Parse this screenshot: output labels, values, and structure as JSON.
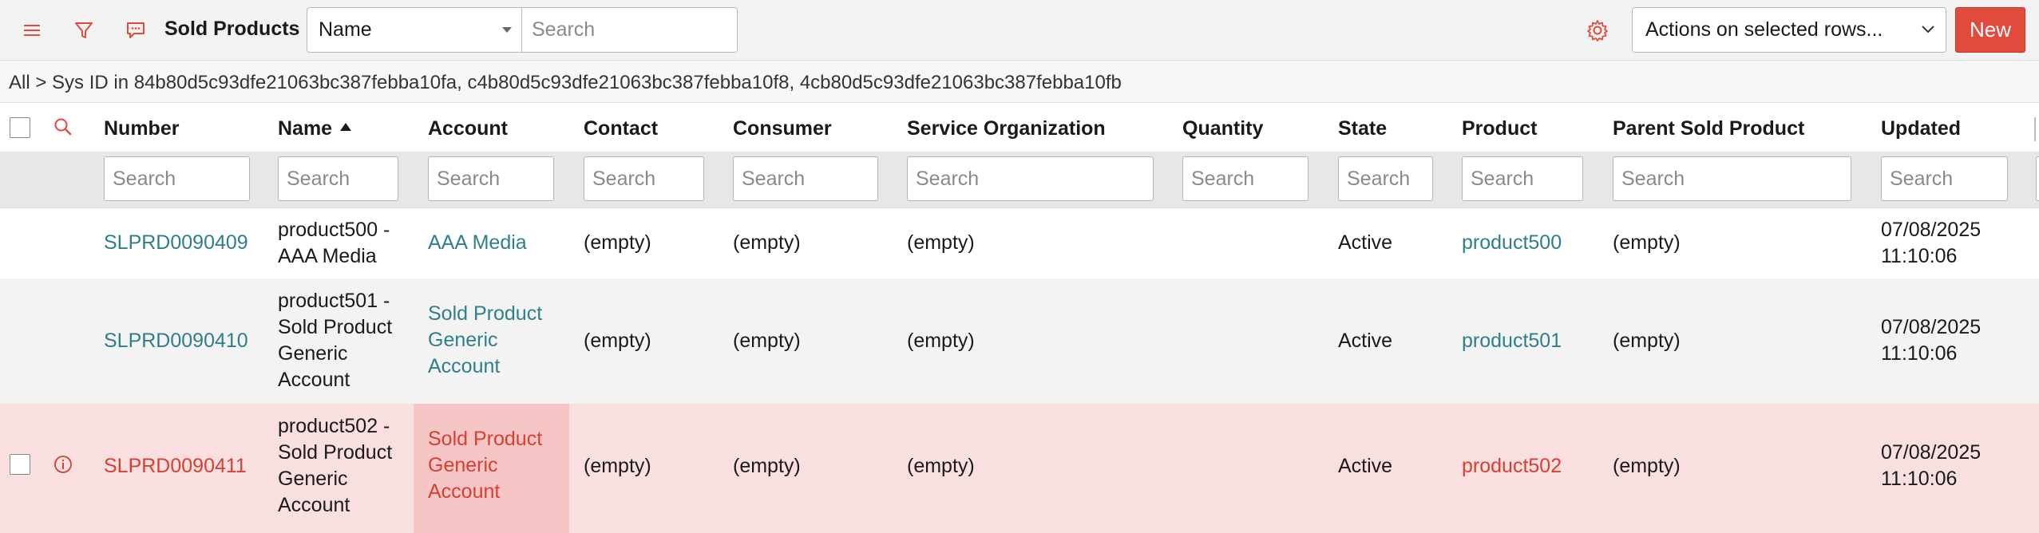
{
  "header": {
    "title": "Sold Products",
    "search_field": "Name",
    "search_placeholder": "Search",
    "actions_label": "Actions on selected rows...",
    "new_label": "New",
    "accent_color": "#e24a3b"
  },
  "breadcrumb": "All > Sys ID in 84b80d5c93dfe21063bc387febba10fa, c4b80d5c93dfe21063bc387febba10f8, 4cb80d5c93dfe21063bc387febba10fb",
  "columns": [
    "Number",
    "Name",
    "Account",
    "Contact",
    "Consumer",
    "Service Organization",
    "Quantity",
    "State",
    "Product",
    "Parent Sold Product",
    "Updated"
  ],
  "column_search_placeholder": "Search",
  "rows": [
    {
      "number": "SLPRD0090409",
      "name": [
        "product500 -",
        "AAA Media"
      ],
      "account": [
        "AAA Media"
      ],
      "contact": "(empty)",
      "consumer": "(empty)",
      "service_org": "(empty)",
      "quantity": "",
      "state": "Active",
      "product": "product500",
      "parent": "(empty)",
      "updated": [
        "07/08/2025",
        "11:10:06"
      ]
    },
    {
      "number": "SLPRD0090410",
      "name": [
        "product501 -",
        "Sold Product",
        "Generic",
        "Account"
      ],
      "account": [
        "Sold Product",
        "Generic",
        "Account"
      ],
      "contact": "(empty)",
      "consumer": "(empty)",
      "service_org": "(empty)",
      "quantity": "",
      "state": "Active",
      "product": "product501",
      "parent": "(empty)",
      "updated": [
        "07/08/2025",
        "11:10:06"
      ]
    },
    {
      "number": "SLPRD0090411",
      "name": [
        "product502 -",
        "Sold Product",
        "Generic",
        "Account"
      ],
      "account": [
        "Sold Product",
        "Generic",
        "Account"
      ],
      "contact": "(empty)",
      "consumer": "(empty)",
      "service_org": "(empty)",
      "quantity": "",
      "state": "Active",
      "product": "product502",
      "parent": "(empty)",
      "updated": [
        "07/08/2025",
        "11:10:06"
      ]
    }
  ]
}
